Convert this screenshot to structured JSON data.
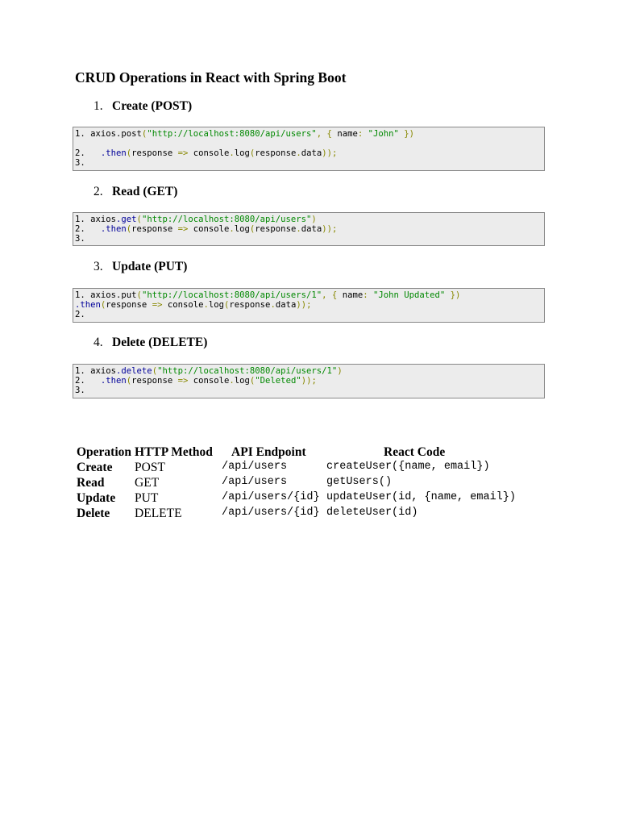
{
  "title": "CRUD Operations in React with Spring Boot",
  "sections": [
    {
      "num": "1.",
      "label": "Create (POST)",
      "lines": [
        [
          [
            "1. axios.",
            "t"
          ],
          [
            "post",
            "t"
          ],
          [
            "(",
            "p"
          ],
          [
            "\"http://localhost:8080/api/users\"",
            "s"
          ],
          [
            ", { ",
            "p"
          ],
          [
            "name",
            "t"
          ],
          [
            ": ",
            "p"
          ],
          [
            "\"John\"",
            "s"
          ],
          [
            " })",
            "p"
          ]
        ],
        [],
        [
          [
            "2.   ",
            "t"
          ],
          [
            ".then",
            "m"
          ],
          [
            "(",
            "p"
          ],
          [
            "response ",
            "t"
          ],
          [
            "=>",
            "p"
          ],
          [
            " console",
            "t"
          ],
          [
            ".",
            "p"
          ],
          [
            "log",
            "t"
          ],
          [
            "(",
            "p"
          ],
          [
            "response",
            "t"
          ],
          [
            ".",
            "p"
          ],
          [
            "data",
            "t"
          ],
          [
            "));",
            "p"
          ]
        ],
        [
          [
            "3.",
            "t"
          ]
        ]
      ]
    },
    {
      "num": "2.",
      "label": "Read (GET)",
      "lines": [
        [
          [
            "1. axios",
            "t"
          ],
          [
            ".get",
            "m"
          ],
          [
            "(",
            "p"
          ],
          [
            "\"http://localhost:8080/api/users\"",
            "s"
          ],
          [
            ")",
            "p"
          ]
        ],
        [
          [
            "2.   ",
            "t"
          ],
          [
            ".then",
            "m"
          ],
          [
            "(",
            "p"
          ],
          [
            "response ",
            "t"
          ],
          [
            "=>",
            "p"
          ],
          [
            " console",
            "t"
          ],
          [
            ".",
            "p"
          ],
          [
            "log",
            "t"
          ],
          [
            "(",
            "p"
          ],
          [
            "response",
            "t"
          ],
          [
            ".",
            "p"
          ],
          [
            "data",
            "t"
          ],
          [
            "));",
            "p"
          ]
        ],
        [
          [
            "3.",
            "t"
          ]
        ]
      ]
    },
    {
      "num": "3.",
      "label": "Update (PUT)",
      "lines": [
        [
          [
            "1. axios.put",
            "t"
          ],
          [
            "(",
            "p"
          ],
          [
            "\"http://localhost:8080/api/users/1\"",
            "s"
          ],
          [
            ", { ",
            "p"
          ],
          [
            "name",
            "t"
          ],
          [
            ": ",
            "p"
          ],
          [
            "\"John Updated\"",
            "s"
          ],
          [
            " })",
            "p"
          ]
        ],
        [
          [
            ".then",
            "m"
          ],
          [
            "(",
            "p"
          ],
          [
            "response ",
            "t"
          ],
          [
            "=>",
            "p"
          ],
          [
            " console",
            "t"
          ],
          [
            ".",
            "p"
          ],
          [
            "log",
            "t"
          ],
          [
            "(",
            "p"
          ],
          [
            "response",
            "t"
          ],
          [
            ".",
            "p"
          ],
          [
            "data",
            "t"
          ],
          [
            "));",
            "p"
          ]
        ],
        [
          [
            "2.",
            "t"
          ]
        ]
      ]
    },
    {
      "num": "4.",
      "label": "Delete (DELETE)",
      "lines": [
        [
          [
            "1. axios",
            "t"
          ],
          [
            ".delete",
            "m"
          ],
          [
            "(",
            "p"
          ],
          [
            "\"http://localhost:8080/api/users/1\"",
            "s"
          ],
          [
            ")",
            "p"
          ]
        ],
        [
          [
            "2.   ",
            "t"
          ],
          [
            ".then",
            "m"
          ],
          [
            "(",
            "p"
          ],
          [
            "response ",
            "t"
          ],
          [
            "=>",
            "p"
          ],
          [
            " console",
            "t"
          ],
          [
            ".",
            "p"
          ],
          [
            "log",
            "t"
          ],
          [
            "(",
            "p"
          ],
          [
            "\"Deleted\"",
            "s"
          ],
          [
            "));",
            "p"
          ]
        ],
        [
          [
            "3.",
            "t"
          ]
        ]
      ]
    }
  ],
  "table": {
    "headers": [
      "Operation",
      "HTTP Method",
      "API Endpoint",
      "React Code"
    ],
    "rows": [
      [
        "Create",
        "POST",
        "/api/users",
        "createUser({name, email})"
      ],
      [
        "Read",
        "GET",
        "/api/users",
        "getUsers()"
      ],
      [
        "Update",
        "PUT",
        "/api/users/{id}",
        "updateUser(id, {name, email})"
      ],
      [
        "Delete",
        "DELETE",
        "/api/users/{id}",
        "deleteUser(id)"
      ]
    ]
  }
}
